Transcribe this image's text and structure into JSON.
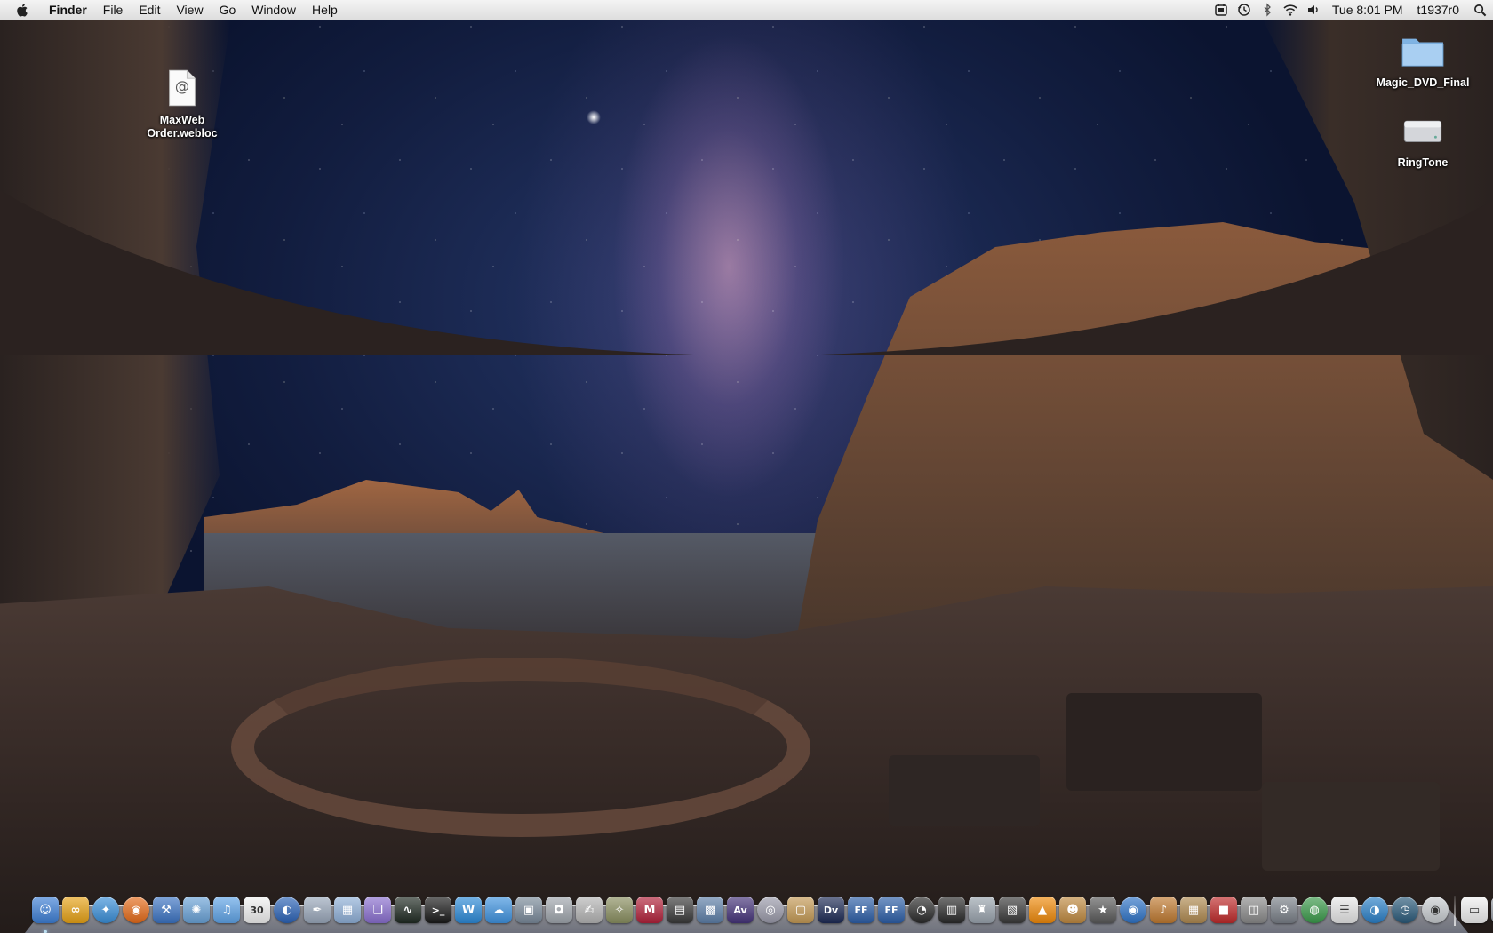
{
  "menubar": {
    "app_name": "Finder",
    "menus": [
      "File",
      "Edit",
      "View",
      "Go",
      "Window",
      "Help"
    ],
    "clock": "Tue 8:01 PM",
    "username": "t1937r0",
    "status_icons": [
      "menu-extra-icon",
      "time-machine-icon",
      "bluetooth-icon",
      "wifi-icon",
      "volume-icon"
    ]
  },
  "desktop": {
    "icons": [
      {
        "label": "MaxWeb\nOrder.webloc",
        "icon": "webloc-file-icon"
      },
      {
        "label": "Magic_DVD_Final",
        "icon": "folder-icon"
      },
      {
        "label": "RingTone",
        "icon": "drive-icon"
      }
    ]
  },
  "dock": {
    "apps": [
      {
        "name": "finder-icon",
        "color": "#3d7fd6",
        "glyph": "☺",
        "running": true
      },
      {
        "name": "photo-booth-icon",
        "color": "#e8a316",
        "glyph": "∞",
        "running": false
      },
      {
        "name": "safari-icon",
        "color": "#3a8fd9",
        "glyph": "✦",
        "running": false
      },
      {
        "name": "firefox-icon",
        "color": "#e66b19",
        "glyph": "◉",
        "running": false
      },
      {
        "name": "xcode-icon",
        "color": "#3c74c4",
        "glyph": "⚒",
        "running": false
      },
      {
        "name": "network-icon",
        "color": "#6aa3d8",
        "glyph": "✺",
        "running": false
      },
      {
        "name": "itunes-icon",
        "color": "#5fa4e8",
        "glyph": "♫",
        "running": false
      },
      {
        "name": "ical-icon",
        "color": "#f2f2f2",
        "glyph": "30",
        "running": false
      },
      {
        "name": "globe-icon",
        "color": "#2b63b7",
        "glyph": "◐",
        "running": false
      },
      {
        "name": "pen-icon",
        "color": "#9aa8bb",
        "glyph": "✒",
        "running": false
      },
      {
        "name": "preview-icon",
        "color": "#8fb0d8",
        "glyph": "▦",
        "running": false
      },
      {
        "name": "stack-icon",
        "color": "#8a6fd0",
        "glyph": "❏",
        "running": false
      },
      {
        "name": "activity-monitor-icon",
        "color": "#1f2a22",
        "glyph": "∿",
        "running": false
      },
      {
        "name": "terminal-icon",
        "color": "#1a1a1a",
        "glyph": ">_",
        "running": false
      },
      {
        "name": "wordpress-icon",
        "color": "#2c8ad8",
        "glyph": "W",
        "running": false
      },
      {
        "name": "ichat-icon",
        "color": "#3f93e0",
        "glyph": "☁",
        "running": false
      },
      {
        "name": "iphoto-icon",
        "color": "#7a8a9a",
        "glyph": "▣",
        "running": false
      },
      {
        "name": "image-capture-icon",
        "color": "#a0a6ad",
        "glyph": "◘",
        "running": false
      },
      {
        "name": "automator-icon",
        "color": "#b5b5b5",
        "glyph": "✍",
        "running": false
      },
      {
        "name": "wand-icon",
        "color": "#8a8f60",
        "glyph": "✧",
        "running": false
      },
      {
        "name": "m2t-icon",
        "color": "#b2213a",
        "glyph": "M",
        "running": false
      },
      {
        "name": "clapper-icon",
        "color": "#3a3a3a",
        "glyph": "▤",
        "running": false
      },
      {
        "name": "iphoto-library-icon",
        "color": "#5d7fa8",
        "glyph": "▩",
        "running": false
      },
      {
        "name": "av-icon",
        "color": "#45337a",
        "glyph": "Av",
        "running": false
      },
      {
        "name": "dvd-player-icon",
        "color": "#9a9aaa",
        "glyph": "◎",
        "running": false
      },
      {
        "name": "package-icon",
        "color": "#c59a55",
        "glyph": "▢",
        "running": false
      },
      {
        "name": "dv-icon",
        "color": "#1d2a55",
        "glyph": "Dv",
        "running": false
      },
      {
        "name": "ff-icon",
        "color": "#2d5fa8",
        "glyph": "FF",
        "running": false
      },
      {
        "name": "ff2-icon",
        "color": "#2d5fa8",
        "glyph": "FF",
        "running": false
      },
      {
        "name": "dashboard-icon",
        "color": "#2a2a2a",
        "glyph": "◔",
        "running": false
      },
      {
        "name": "movie-icon",
        "color": "#2a2a2a",
        "glyph": "▥",
        "running": false
      },
      {
        "name": "joystick-icon",
        "color": "#9aa4ae",
        "glyph": "♜",
        "running": false
      },
      {
        "name": "final-cut-icon",
        "color": "#3a3a3a",
        "glyph": "▧",
        "running": false
      },
      {
        "name": "vlc-icon",
        "color": "#f08a0a",
        "glyph": "▲",
        "running": false
      },
      {
        "name": "image-editor-icon",
        "color": "#c08a40",
        "glyph": "☻",
        "running": false
      },
      {
        "name": "imovie-icon",
        "color": "#5a5a5a",
        "glyph": "★",
        "running": false
      },
      {
        "name": "quicktime-icon",
        "color": "#2f74c8",
        "glyph": "◉",
        "running": false
      },
      {
        "name": "garageband-icon",
        "color": "#c07a30",
        "glyph": "♪",
        "running": false
      },
      {
        "name": "photo-viewer-icon",
        "color": "#b08a50",
        "glyph": "▦",
        "running": false
      },
      {
        "name": "red-app-icon",
        "color": "#c02a2a",
        "glyph": "■",
        "running": false
      },
      {
        "name": "disk-utility-icon",
        "color": "#8a8a8a",
        "glyph": "◫",
        "running": false
      },
      {
        "name": "system-preferences-icon",
        "color": "#7a8088",
        "glyph": "⚙",
        "running": false
      },
      {
        "name": "network-globe-icon",
        "color": "#3a9a4a",
        "glyph": "◍",
        "running": false
      },
      {
        "name": "text-edit-icon",
        "color": "#e8e8e8",
        "glyph": "☰",
        "running": false
      },
      {
        "name": "world-icon",
        "color": "#2a80c8",
        "glyph": "◑",
        "running": false
      },
      {
        "name": "time-machine-dock-icon",
        "color": "#2a5a7a",
        "glyph": "◷",
        "running": false
      },
      {
        "name": "webcam-icon",
        "color": "#c8ccd0",
        "glyph": "◉",
        "running": false
      },
      {
        "name": "documents-stack-icon",
        "color": "#f0f0f0",
        "glyph": "▭",
        "running": false
      },
      {
        "name": "trash-icon",
        "color": "#9aa0a8",
        "glyph": "⌫",
        "running": false
      }
    ]
  }
}
